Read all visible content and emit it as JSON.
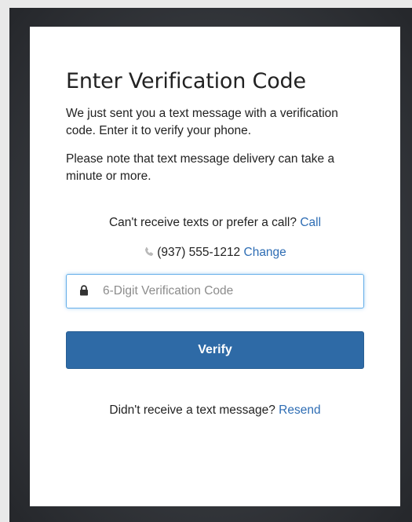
{
  "card": {
    "title": "Enter Verification Code",
    "message": "We just sent you a text message with a verification code. Enter it to verify your phone.",
    "note": "Please note that text message delivery can take a minute or more."
  },
  "call_option": {
    "prompt": "Can't receive texts or prefer a call?",
    "link_label": "Call"
  },
  "phone": {
    "icon": "phone-icon",
    "number": "(937) 555-1212",
    "change_label": "Change"
  },
  "code_field": {
    "icon": "lock-icon",
    "value": "",
    "placeholder": "6-Digit Verification Code"
  },
  "verify_button": {
    "label": "Verify"
  },
  "resend": {
    "prompt": "Didn't receive a text message?",
    "link_label": "Resend"
  },
  "colors": {
    "link": "#2e6db4",
    "button": "#2e6aa6",
    "focus_border": "#66afe9",
    "backdrop": "#3a3d42"
  }
}
